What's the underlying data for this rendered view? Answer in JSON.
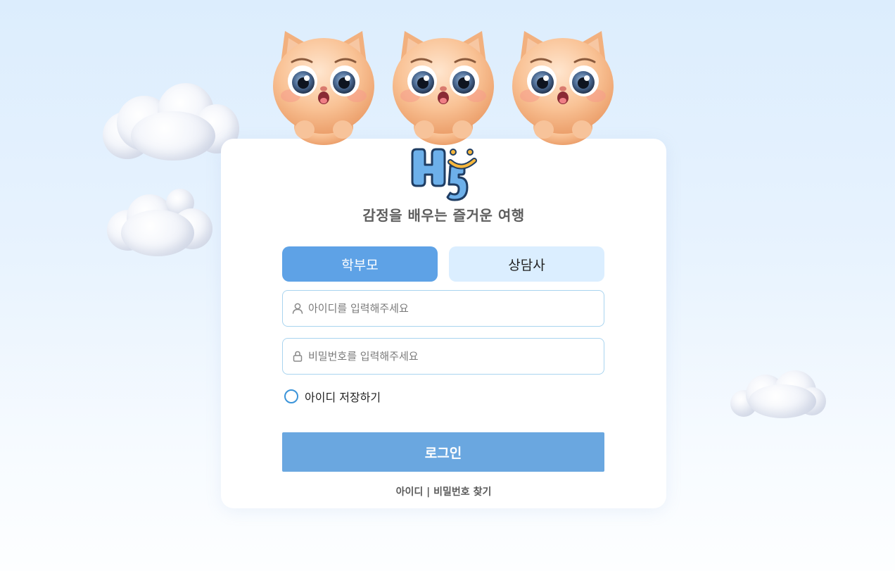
{
  "tagline": "감정을 배우는 즐거운 여행",
  "logo": {
    "icon": "hi-smile-logo"
  },
  "tabs": [
    {
      "label": "학부모",
      "active": true
    },
    {
      "label": "상담사",
      "active": false
    }
  ],
  "fields": {
    "id": {
      "placeholder": "아이디를 입력해주세요",
      "value": "",
      "icon": "user-icon"
    },
    "password": {
      "placeholder": "비밀번호를 입력해주세요",
      "value": "",
      "icon": "lock-icon"
    }
  },
  "remember": {
    "label": "아이디 저장하기",
    "checked": false
  },
  "login_button": {
    "label": "로그인"
  },
  "find_links": {
    "find_id": "아이디",
    "separator": " | ",
    "find_password": "비밀번호 찾기"
  },
  "colors": {
    "primary": "#5ea2e6",
    "tab_inactive": "#dbeeff",
    "login_button": "#6aa7e0",
    "input_border": "#a9d4ef",
    "radio": "#3b94d9"
  }
}
